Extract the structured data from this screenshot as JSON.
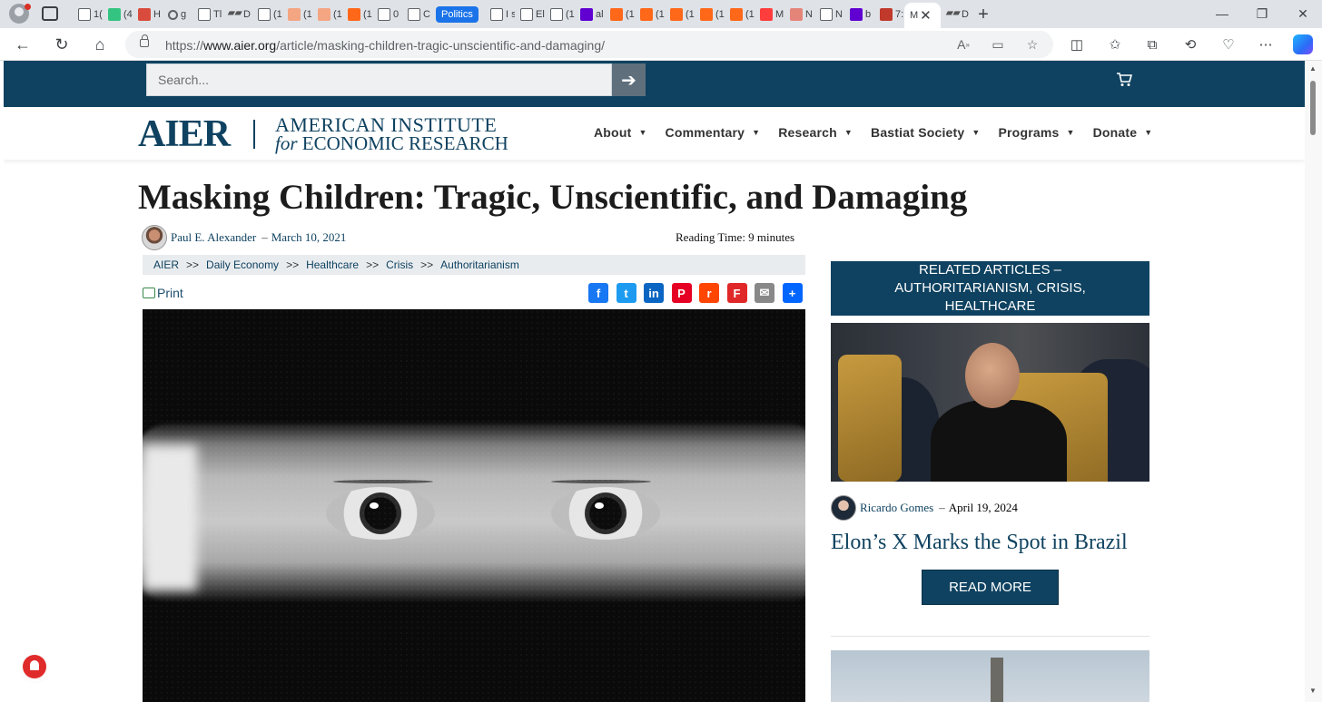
{
  "browser": {
    "tabs": [
      {
        "label": "1(",
        "icon": "doc"
      },
      {
        "label": "(4",
        "icon": "g"
      },
      {
        "label": "H",
        "icon": "red"
      },
      {
        "label": "g",
        "icon": "search"
      },
      {
        "label": "Tl",
        "icon": "doc"
      },
      {
        "label": "D",
        "icon": "dash"
      },
      {
        "label": "(1",
        "icon": "doc"
      },
      {
        "label": "(1",
        "icon": "subs-light"
      },
      {
        "label": "(1",
        "icon": "subs-light"
      },
      {
        "label": "(1",
        "icon": "subs"
      },
      {
        "label": "0",
        "icon": "doc"
      },
      {
        "label": "C",
        "icon": "doc"
      }
    ],
    "politics_tab": "Politics",
    "tabs_after": [
      {
        "label": "I s",
        "icon": "doc"
      },
      {
        "label": "El",
        "icon": "doc"
      },
      {
        "label": "(1",
        "icon": "doc"
      },
      {
        "label": "al",
        "icon": "yahoo"
      },
      {
        "label": "(1",
        "icon": "subs"
      },
      {
        "label": "(1",
        "icon": "subs"
      },
      {
        "label": "(1",
        "icon": "subs"
      },
      {
        "label": "(1",
        "icon": "subs"
      },
      {
        "label": "(1",
        "icon": "subs"
      },
      {
        "label": "M",
        "icon": "yt"
      },
      {
        "label": "N",
        "icon": "rr"
      },
      {
        "label": "N",
        "icon": "mail"
      },
      {
        "label": "b",
        "icon": "yahoo"
      },
      {
        "label": "7:",
        "icon": "bi"
      }
    ],
    "active_tab": "M",
    "last_tab": {
      "label": "D",
      "icon": "dash"
    },
    "url_prefix": "https://",
    "url_host": "www.aier.org",
    "url_path": "/article/masking-children-tragic-unscientific-and-damaging/"
  },
  "site": {
    "search_placeholder": "Search...",
    "search_arrow": "➔",
    "logo_mark": "AIER",
    "logo_line1": "AMERICAN INSTITUTE",
    "logo_for": "for",
    "logo_line2": "ECONOMIC RESEARCH",
    "nav": [
      "About",
      "Commentary",
      "Research",
      "Bastiat Society",
      "Programs",
      "Donate"
    ],
    "colors": {
      "brand": "#0f4260"
    }
  },
  "article": {
    "title": "Masking Children: Tragic, Unscientific, and Damaging",
    "author": "Paul E. Alexander",
    "date_sep": "–",
    "date": "March 10, 2021",
    "reading_time": "Reading Time: 9 minutes",
    "breadcrumb": [
      "AIER",
      "Daily Economy",
      "Healthcare",
      "Crisis",
      "Authoritarianism"
    ],
    "breadcrumb_sep": ">>",
    "print_label": "Print",
    "share": [
      {
        "name": "facebook",
        "glyph": "f",
        "color": "#1877f2"
      },
      {
        "name": "twitter",
        "glyph": "t",
        "color": "#1d9bf0"
      },
      {
        "name": "linkedin",
        "glyph": "in",
        "color": "#0a66c2"
      },
      {
        "name": "pinterest",
        "glyph": "P",
        "color": "#e60023"
      },
      {
        "name": "reddit",
        "glyph": "r",
        "color": "#ff4500"
      },
      {
        "name": "flipboard",
        "glyph": "F",
        "color": "#e12828"
      },
      {
        "name": "email",
        "glyph": "✉",
        "color": "#888888"
      },
      {
        "name": "share",
        "glyph": "+",
        "color": "#0166ff"
      }
    ]
  },
  "sidebar": {
    "header": "RELATED ARTICLES – AUTHORITARIANISM, CRISIS, HEALTHCARE",
    "author": "Ricardo Gomes",
    "date_sep": "–",
    "date": "April 19, 2024",
    "title": "Elon’s X Marks the Spot in Brazil",
    "read_more": "READ MORE"
  }
}
